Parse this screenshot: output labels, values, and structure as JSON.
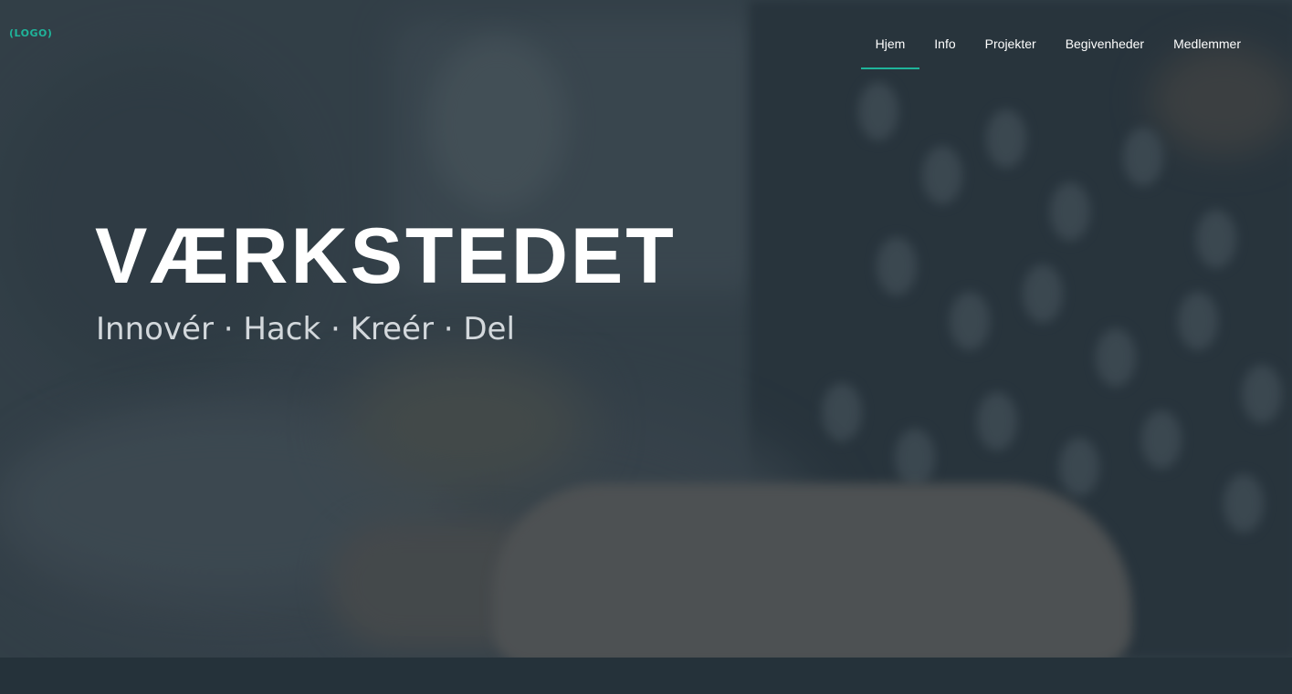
{
  "header": {
    "logo_text": "(LOGO)",
    "nav": [
      {
        "label": "Hjem",
        "active": true
      },
      {
        "label": "Info",
        "active": false
      },
      {
        "label": "Projekter",
        "active": false
      },
      {
        "label": "Begivenheder",
        "active": false
      },
      {
        "label": "Medlemmer",
        "active": false
      }
    ]
  },
  "hero": {
    "title": "VÆRKSTEDET",
    "tagline": "Innovér · Hack · Kreér · Del",
    "background": "blurred-photo-hand-on-laptop"
  },
  "colors": {
    "accent": "#1fb49a",
    "background_dark": "#25323a",
    "text_light": "#ffffff"
  }
}
